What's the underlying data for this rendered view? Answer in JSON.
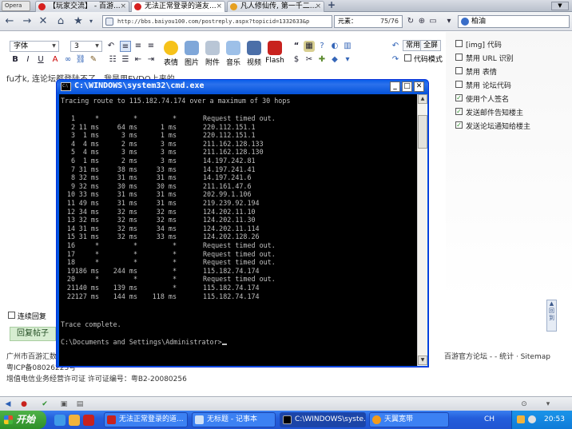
{
  "browser": {
    "opera_button": "Opera",
    "tabs": [
      {
        "label": "【玩家交流】 - 百游..."
      },
      {
        "label": "无法正常登录的道友..."
      },
      {
        "label": "凡人修仙传, 第一千二..."
      }
    ],
    "address": "http://bbs.baiyou100.com/postreply.aspx?topicid=1332633&p",
    "address_domain": "baiyou100",
    "meta_label": "元素：",
    "meta_count": "75/76",
    "search_value": "柏油"
  },
  "editor": {
    "font_select": "字体",
    "size_select": "3",
    "buttons": [
      "表情",
      "图片",
      "附件",
      "音乐",
      "视频",
      "Flash"
    ],
    "mode_buttons": [
      "常用",
      "全屏"
    ],
    "code_mode_label": "代码模式",
    "body_text": "fu才k, 连论坛都登陆不了。我是用EVDO上来的。"
  },
  "sidebar": {
    "options": [
      {
        "label": "[img] 代码",
        "checked": false
      },
      {
        "label": "禁用 URL 识别",
        "checked": false
      },
      {
        "label": "禁用 表情",
        "checked": false
      },
      {
        "label": "禁用 论坛代码",
        "checked": false
      },
      {
        "label": "使用个人签名",
        "checked": true
      },
      {
        "label": "发送邮件告知楼主",
        "checked": true
      },
      {
        "label": "发送论坛通知给楼主",
        "checked": true
      }
    ]
  },
  "page": {
    "reply_checkbox_label": "连续回复",
    "reply_button": "回复帖子",
    "footer_left": "广州市百游汇数",
    "footer_icp": "粤ICP备08026223号",
    "footer_license": "增值电信业务经营许可证 许可证编号：粤B2-20080256",
    "footer_right": "百游官方论坛 - - 统计 · Sitemap"
  },
  "cmd": {
    "title": "C:\\WINDOWS\\system32\\cmd.exe",
    "header_line": "Tracing route to 115.182.74.174 over a maximum of 30 hops",
    "hops": [
      {
        "hop": "1",
        "t1": "*",
        "t2": "*",
        "t3": "*",
        "host": "Request timed out."
      },
      {
        "hop": "2",
        "t1": "11 ms",
        "t2": "64 ms",
        "t3": "1 ms",
        "host": "220.112.151.1"
      },
      {
        "hop": "3",
        "t1": "1 ms",
        "t2": "3 ms",
        "t3": "1 ms",
        "host": "220.112.151.1"
      },
      {
        "hop": "4",
        "t1": "4 ms",
        "t2": "2 ms",
        "t3": "3 ms",
        "host": "211.162.128.133"
      },
      {
        "hop": "5",
        "t1": "4 ms",
        "t2": "3 ms",
        "t3": "3 ms",
        "host": "211.162.128.130"
      },
      {
        "hop": "6",
        "t1": "1 ms",
        "t2": "2 ms",
        "t3": "3 ms",
        "host": "14.197.242.81"
      },
      {
        "hop": "7",
        "t1": "31 ms",
        "t2": "38 ms",
        "t3": "33 ms",
        "host": "14.197.241.41"
      },
      {
        "hop": "8",
        "t1": "32 ms",
        "t2": "31 ms",
        "t3": "31 ms",
        "host": "14.197.241.6"
      },
      {
        "hop": "9",
        "t1": "32 ms",
        "t2": "30 ms",
        "t3": "30 ms",
        "host": "211.161.47.6"
      },
      {
        "hop": "10",
        "t1": "33 ms",
        "t2": "31 ms",
        "t3": "31 ms",
        "host": "202.99.1.106"
      },
      {
        "hop": "11",
        "t1": "49 ms",
        "t2": "31 ms",
        "t3": "31 ms",
        "host": "219.239.92.194"
      },
      {
        "hop": "12",
        "t1": "34 ms",
        "t2": "32 ms",
        "t3": "32 ms",
        "host": "124.202.11.10"
      },
      {
        "hop": "13",
        "t1": "32 ms",
        "t2": "32 ms",
        "t3": "32 ms",
        "host": "124.202.11.30"
      },
      {
        "hop": "14",
        "t1": "31 ms",
        "t2": "32 ms",
        "t3": "34 ms",
        "host": "124.202.11.114"
      },
      {
        "hop": "15",
        "t1": "31 ms",
        "t2": "32 ms",
        "t3": "33 ms",
        "host": "124.202.128.26"
      },
      {
        "hop": "16",
        "t1": "*",
        "t2": "*",
        "t3": "*",
        "host": "Request timed out."
      },
      {
        "hop": "17",
        "t1": "*",
        "t2": "*",
        "t3": "*",
        "host": "Request timed out."
      },
      {
        "hop": "18",
        "t1": "*",
        "t2": "*",
        "t3": "*",
        "host": "Request timed out."
      },
      {
        "hop": "19",
        "t1": "186 ms",
        "t2": "244 ms",
        "t3": "*",
        "host": "115.182.74.174"
      },
      {
        "hop": "20",
        "t1": "*",
        "t2": "*",
        "t3": "*",
        "host": "Request timed out."
      },
      {
        "hop": "21",
        "t1": "140 ms",
        "t2": "139 ms",
        "t3": "*",
        "host": "115.182.74.174"
      },
      {
        "hop": "22",
        "t1": "127 ms",
        "t2": "144 ms",
        "t3": "118 ms",
        "host": "115.182.74.174"
      }
    ],
    "complete_line": "Trace complete.",
    "prompt": "C:\\Documents and Settings\\Administrator>"
  },
  "taskbar": {
    "start_label": "开始",
    "tasks": [
      {
        "label": "无法正常登录的道..."
      },
      {
        "label": "无标题 - 记事本"
      },
      {
        "label": "C:\\WINDOWS\\syste..."
      },
      {
        "label": "天翼宽带"
      }
    ],
    "lang": "CH",
    "clock": "20:53"
  },
  "colors": {
    "console_bg": "#000000",
    "console_text": "#c0c0c0",
    "xp_blue": "#0054e3",
    "taskbar": "#245edb",
    "start_green": "#3c9a35"
  }
}
